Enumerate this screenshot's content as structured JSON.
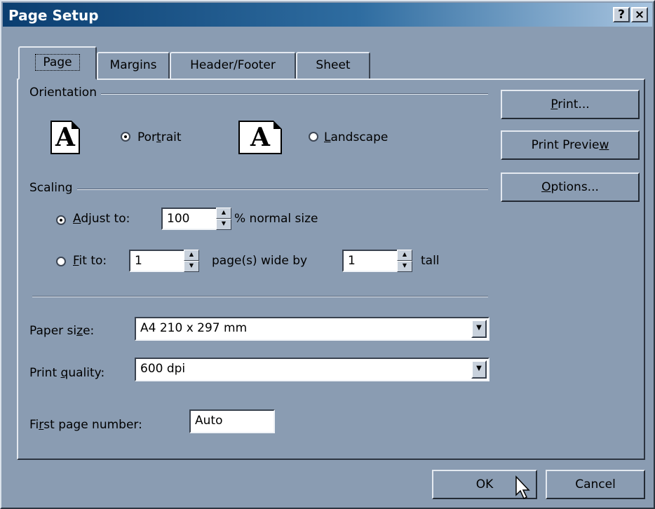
{
  "window": {
    "title": "Page Setup",
    "help_label": "?",
    "close_label": "×"
  },
  "tabs": [
    {
      "label": "Page"
    },
    {
      "label": "Margins"
    },
    {
      "label": "Header/Footer"
    },
    {
      "label": "Sheet"
    }
  ],
  "orientation": {
    "group_label": "Orientation",
    "portrait": {
      "before": "Por",
      "underline": "t",
      "after": "rait",
      "icon_letter": "A",
      "selected": true
    },
    "landscape": {
      "before": "",
      "underline": "L",
      "after": "andscape",
      "icon_letter": "A",
      "selected": false
    }
  },
  "scaling": {
    "group_label": "Scaling",
    "adjust": {
      "underline": "A",
      "after": "djust to:",
      "value": "100",
      "suffix": "% normal size",
      "selected": true
    },
    "fit": {
      "underline": "F",
      "after": "it to:",
      "wide_value": "1",
      "wide_suffix": "page(s) wide by",
      "tall_value": "1",
      "tall_suffix": "tall",
      "selected": false
    }
  },
  "paper_size": {
    "before": "Paper si",
    "underline": "z",
    "after": "e:",
    "value": "A4 210 x 297 mm"
  },
  "print_quality": {
    "before": "Print ",
    "underline": "q",
    "after": "uality:",
    "value": "600 dpi"
  },
  "first_page": {
    "before": "Fi",
    "underline": "r",
    "after": "st page number:",
    "value": "Auto"
  },
  "side_buttons": {
    "print": {
      "before": "",
      "underline": "P",
      "after": "rint..."
    },
    "preview": {
      "before": "Print Previe",
      "underline": "w",
      "after": ""
    },
    "options": {
      "before": "",
      "underline": "O",
      "after": "ptions..."
    }
  },
  "footer": {
    "ok_label": "OK",
    "cancel_label": "Cancel"
  }
}
